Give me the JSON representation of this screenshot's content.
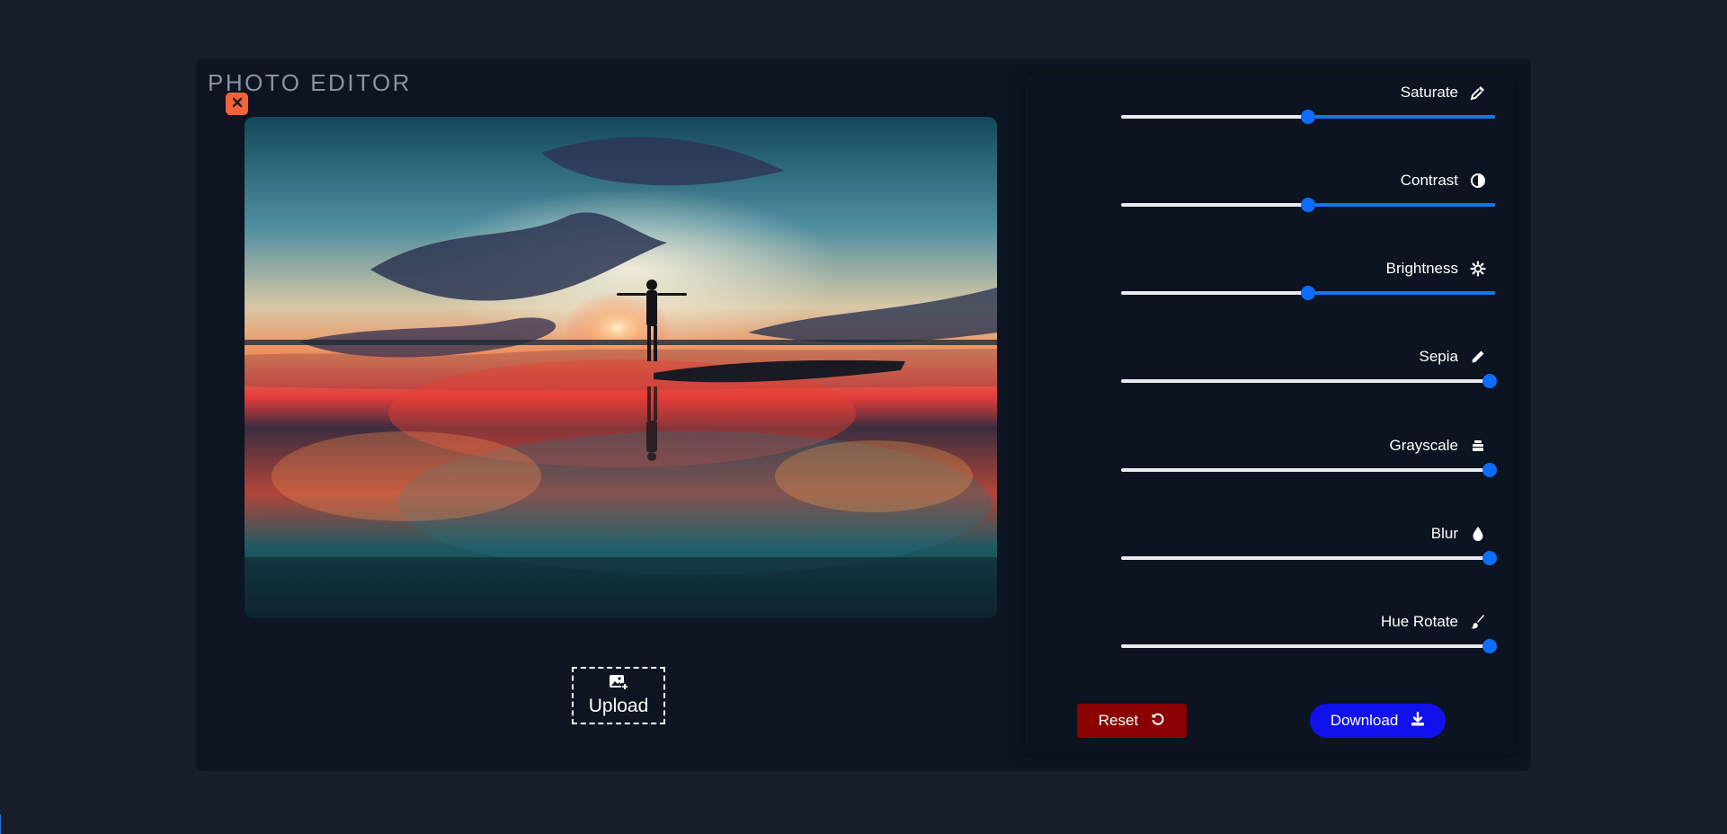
{
  "app": {
    "title": "PHOTO EDITOR"
  },
  "image": {
    "close_icon": "close-icon",
    "description_icon": "sunset-photo"
  },
  "upload": {
    "label": "Upload",
    "icon": "image-plus-icon"
  },
  "filters": [
    {
      "id": "saturate",
      "label": "Saturate",
      "icon": "eyedropper-icon",
      "value": 0.5
    },
    {
      "id": "contrast",
      "label": "Contrast",
      "icon": "contrast-icon",
      "value": 0.5
    },
    {
      "id": "brightness",
      "label": "Brightness",
      "icon": "sun-icon",
      "value": 0.5
    },
    {
      "id": "sepia",
      "label": "Sepia",
      "icon": "pencil-icon",
      "value": 1.0
    },
    {
      "id": "grayscale",
      "label": "Grayscale",
      "icon": "layers-icon",
      "value": 1.0
    },
    {
      "id": "blur",
      "label": "Blur",
      "icon": "droplet-icon",
      "value": 1.0
    },
    {
      "id": "hue_rotate",
      "label": "Hue Rotate",
      "icon": "brush-icon",
      "value": 1.0
    }
  ],
  "actions": {
    "reset_label": "Reset",
    "download_label": "Download"
  },
  "colors": {
    "background": "#171e2a",
    "panel": "#0b1420",
    "slider_accent": "#0d6efd",
    "reset": "#8b0000",
    "download": "#1111ee",
    "close": "#f4623a"
  }
}
